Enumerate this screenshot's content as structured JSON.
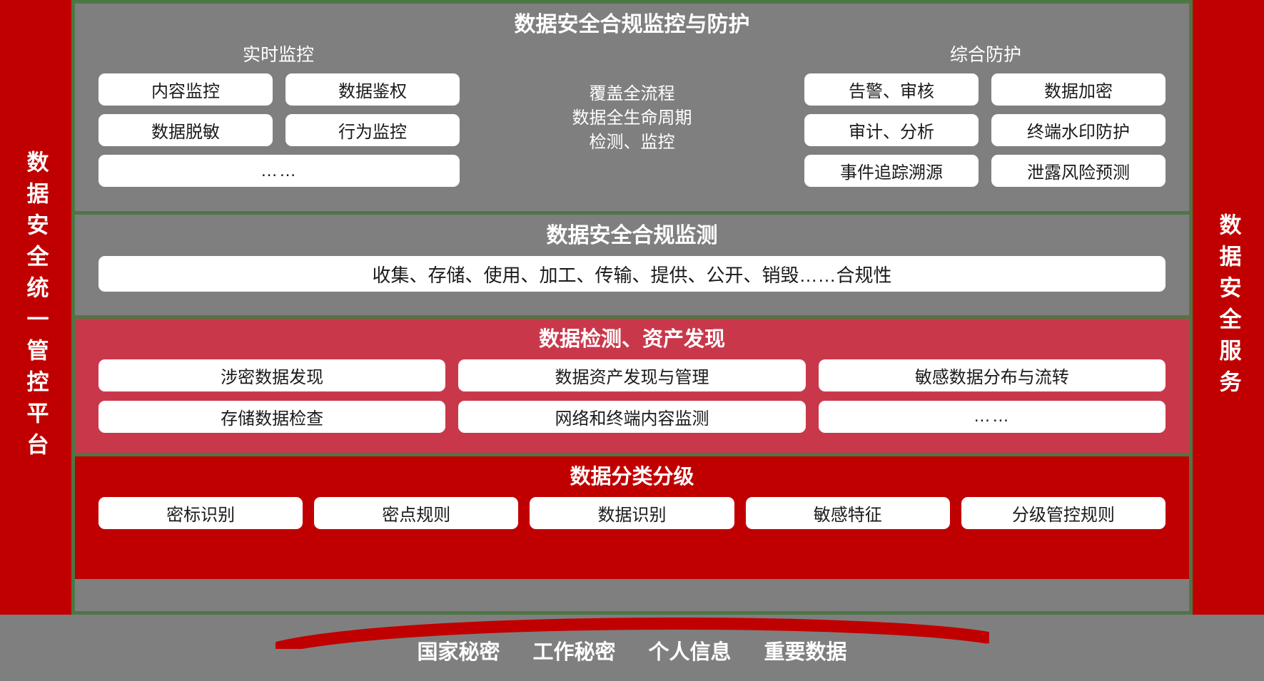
{
  "platform": {
    "left_rail_label": "数据安全统一管控平台",
    "right_rail_label": "数据安全服务"
  },
  "colors": {
    "brand_red": "#c00000",
    "pink_red": "#c9384a",
    "gray": "#7f7f7f",
    "green_border": "#4e7645",
    "chip_white": "#ffffff"
  },
  "layers": [
    {
      "id": "monitoring-protection",
      "title": "数据安全合规监控与防护",
      "left_group": {
        "subhead": "实时监控",
        "chips": [
          "内容监控",
          "数据鉴权",
          "数据脱敏",
          "行为监控"
        ],
        "full_chip": "……"
      },
      "center_note_lines": [
        "覆盖全流程",
        "数据全生命周期",
        "检测、监控"
      ],
      "right_group": {
        "subhead": "综合防护",
        "chips": [
          "告警、审核",
          "数据加密",
          "审计、分析",
          "终端水印防护",
          "事件追踪溯源",
          "泄露风险预测"
        ]
      }
    },
    {
      "id": "compliance-monitoring",
      "title": "数据安全合规监测",
      "wide_chip": "收集、存储、使用、加工、传输、提供、公开、销毁……合规性"
    },
    {
      "id": "detection-asset-discovery",
      "title": "数据检测、资产发现",
      "chips": [
        "涉密数据发现",
        "数据资产发现与管理",
        "敏感数据分布与流转",
        "存储数据检查",
        "网络和终端内容监测",
        "……"
      ]
    },
    {
      "id": "classification-grading",
      "title": "数据分类分级",
      "chips": [
        "密标识别",
        "密点规则",
        "数据识别",
        "敏感特征",
        "分级管控规则"
      ]
    }
  ],
  "bottom_bar": {
    "labels": [
      "国家秘密",
      "工作秘密",
      "个人信息",
      "重要数据"
    ]
  }
}
